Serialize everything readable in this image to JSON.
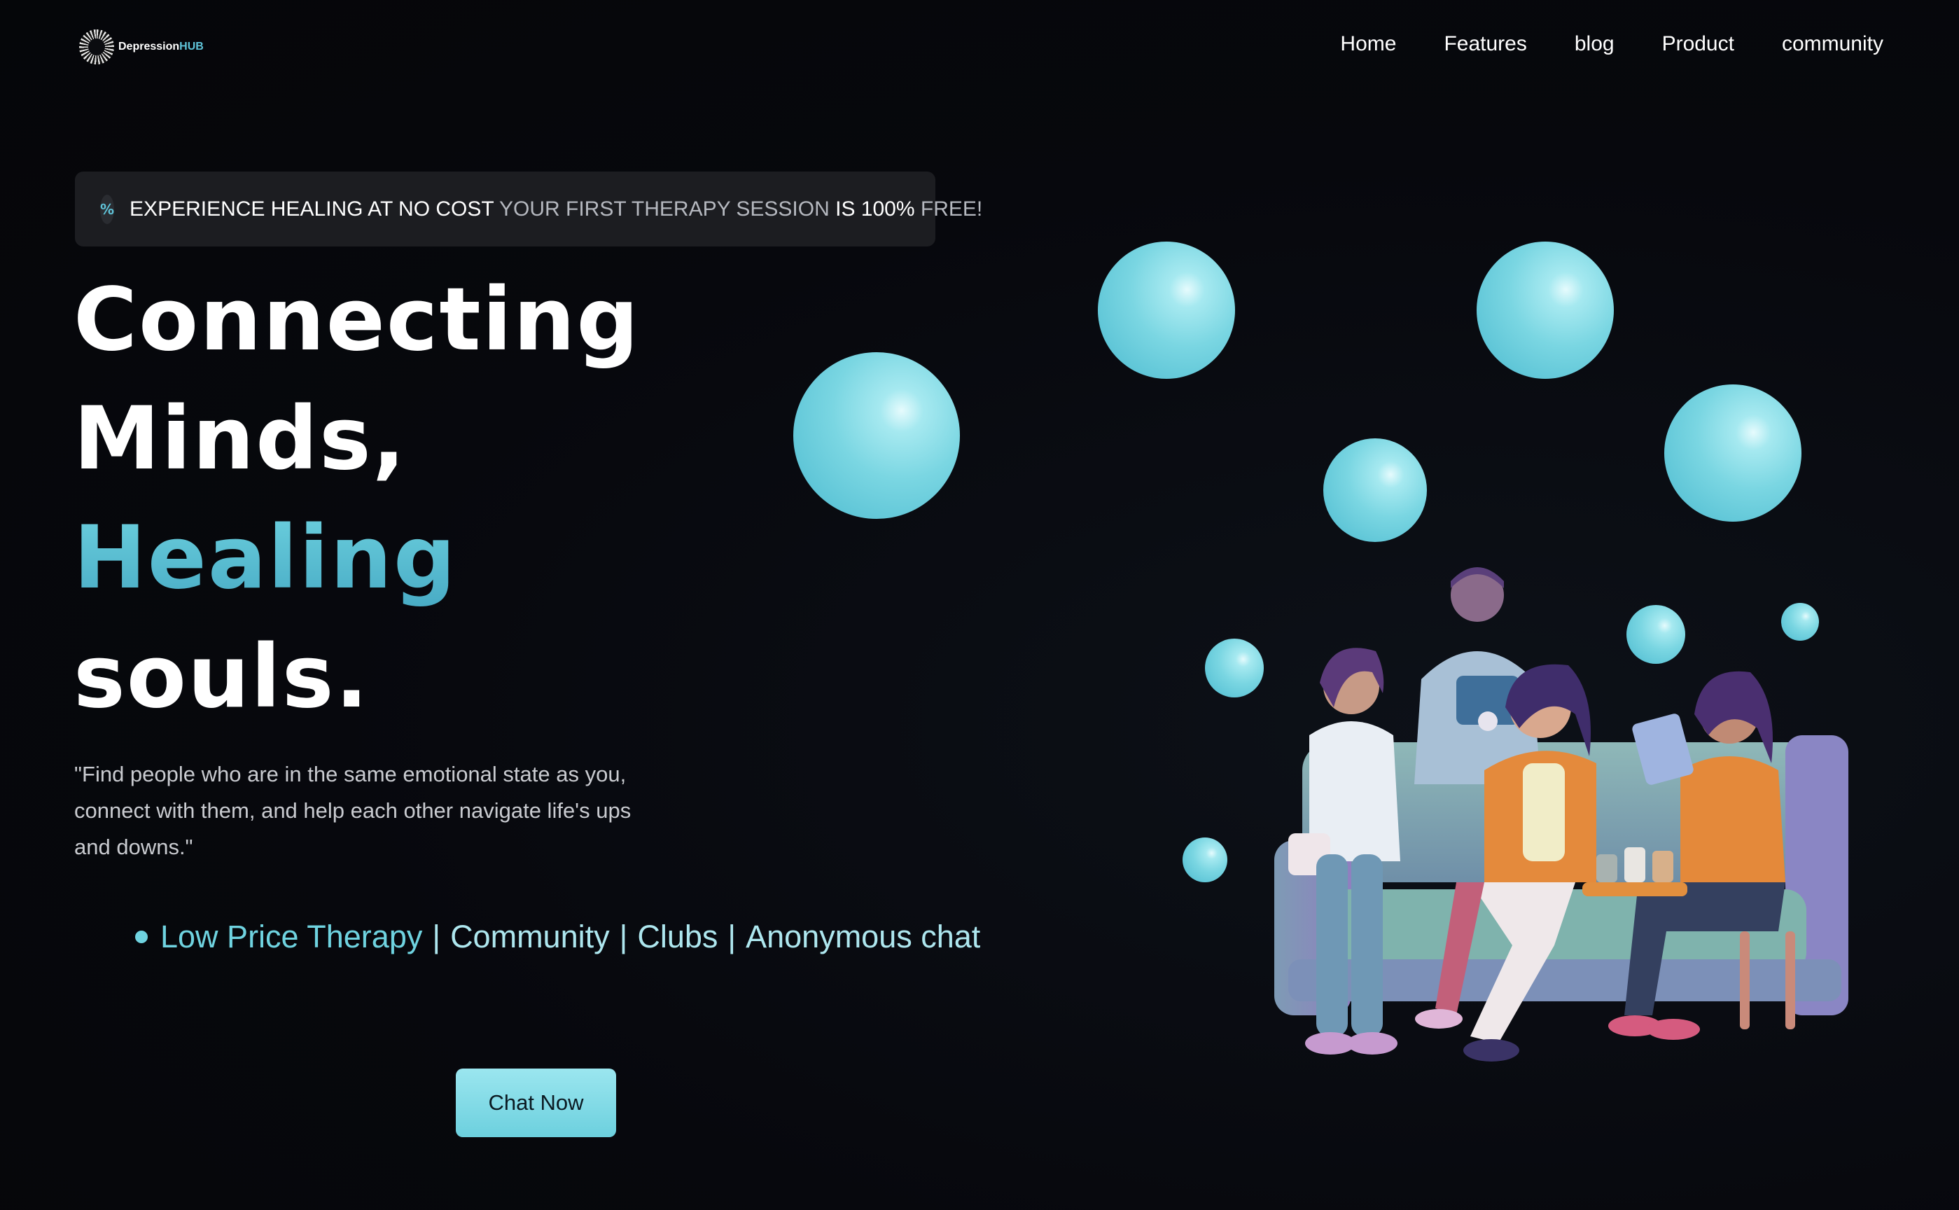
{
  "brand": {
    "name_part1": "Depression",
    "name_part2": "HUB"
  },
  "nav": [
    "Home",
    "Features",
    "blog",
    "Product",
    "community"
  ],
  "banner": {
    "icon": "percent-icon",
    "lead": "EXPERIENCE HEALING AT NO COST",
    "middle": "YOUR FIRST THERAPY SESSION",
    "strong": "IS 100%",
    "tail": "FREE!"
  },
  "hero": {
    "line1": "Connecting",
    "line2": "Minds,",
    "line3": "Healing",
    "line4": "souls.",
    "quote": "\"Find people who are in the same emotional state as you, connect with them, and help each other navigate life's ups and downs.\""
  },
  "features": {
    "item1": "Low Price Therapy",
    "item2": "Community",
    "item3": "Clubs",
    "item4": "Anonymous chat",
    "separator": "|"
  },
  "cta": {
    "label": "Chat Now"
  },
  "colors": {
    "accent": "#6fd3e0",
    "background": "#07080d",
    "banner_bg": "#1c1d21"
  }
}
